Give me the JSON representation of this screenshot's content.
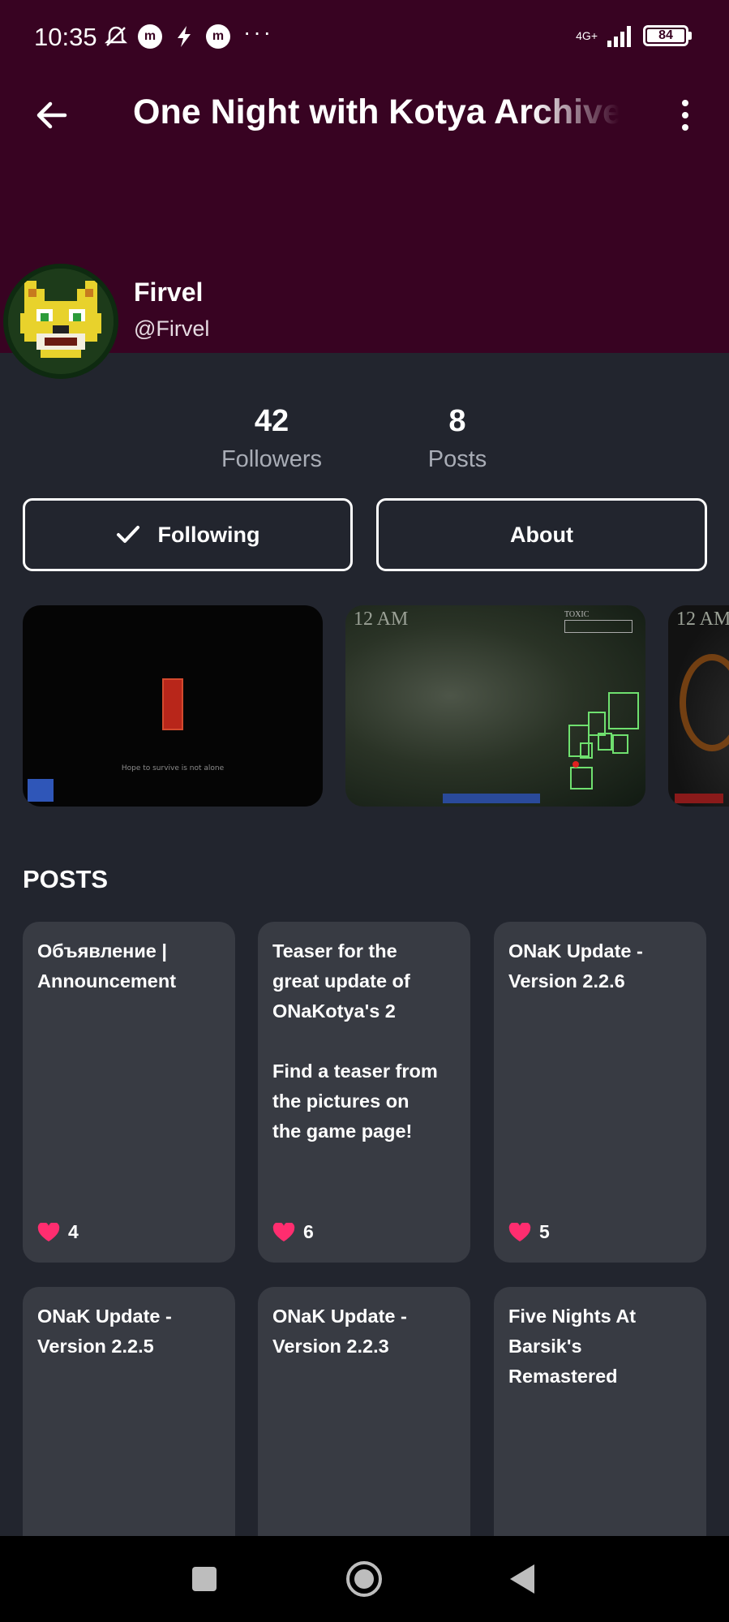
{
  "status_bar": {
    "time": "10:35",
    "left_icons": [
      "bell-off-icon",
      "m-icon",
      "flash-icon",
      "m-icon"
    ],
    "dots": "···",
    "network": "4G+",
    "battery": "84"
  },
  "appbar": {
    "title": "One Night with Kotya Archive",
    "back_icon": "arrow-left-icon",
    "menu_icon": "more-vert-icon"
  },
  "profile": {
    "name": "Firvel",
    "handle": "@Firvel",
    "avatar": "pixel-fox-avatar"
  },
  "stats": [
    {
      "value": "42",
      "label": "Followers"
    },
    {
      "value": "8",
      "label": "Posts"
    }
  ],
  "buttons": {
    "following_label": "Following",
    "about_label": "About"
  },
  "gallery": {
    "items": [
      {
        "caption": "Hope to survive is not alone"
      },
      {
        "time_label": "12 AM",
        "meter_label": "TOXIC"
      },
      {
        "time_label": "12 AM"
      }
    ]
  },
  "posts_section": {
    "title": "POSTS",
    "items": [
      {
        "title": "Объявление |\nAnnouncement",
        "likes": "4"
      },
      {
        "title": "Teaser for the\ngreat update of\nONaKotya's 2\n\nFind a teaser from\nthe pictures on\nthe game page!",
        "likes": "6"
      },
      {
        "title": "ONaK Update -\nVersion 2.2.6",
        "likes": "5"
      },
      {
        "title": "ONaK Update -\nVersion 2.2.5",
        "likes": ""
      },
      {
        "title": "ONaK Update -\nVersion 2.2.3",
        "likes": ""
      },
      {
        "title": "Five Nights At\nBarsik's\nRemastered",
        "likes": ""
      }
    ]
  },
  "colors": {
    "header_bg": "#380322",
    "page_bg": "#22252e",
    "card_bg": "#383b43",
    "heart": "#ff2d6f",
    "muted_text": "#a9adb6"
  },
  "navbar": {
    "icons": [
      "recents-square-icon",
      "home-circle-icon",
      "back-triangle-icon"
    ]
  }
}
